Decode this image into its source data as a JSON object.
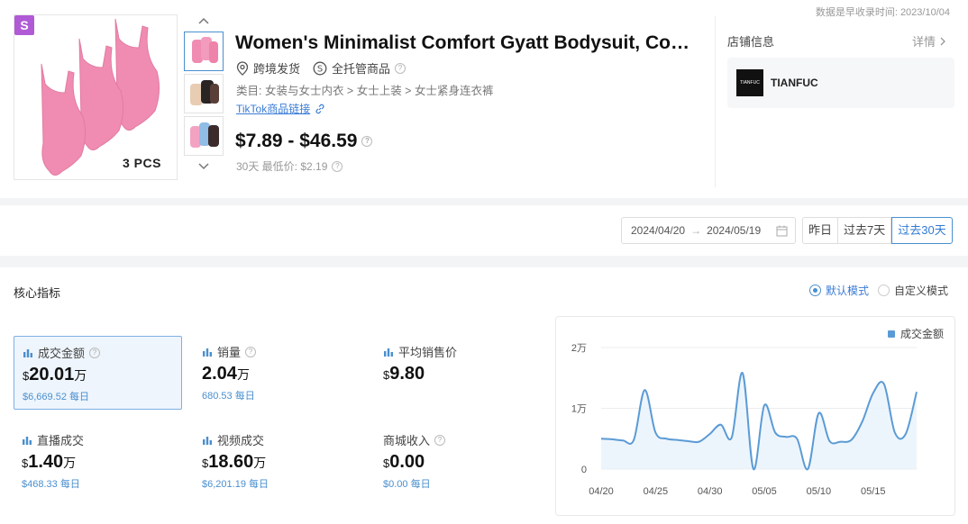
{
  "record_time": "数据是早收录时间: 2023/10/04",
  "product": {
    "badge": "S",
    "pcs_label": "3 PCS",
    "title": "Women's Minimalist Comfort Gyatt Bodysuit, Comf...",
    "shipping": "跨境发货",
    "managed": "全托管商品",
    "category": "类目: 女装与女士内衣 > 女士上装 > 女士紧身连衣裤",
    "tiktok_link": "TikTok商品链接",
    "price": "$7.89 - $46.59",
    "low_price": "30天 最低价: $2.19"
  },
  "shop": {
    "title": "店铺信息",
    "detail": "详情",
    "logo_text": "TIANFUC",
    "name": "TIANFUC"
  },
  "date_filter": {
    "start": "2024/04/20",
    "arrow": "→",
    "end": "2024/05/19",
    "buttons": [
      "昨日",
      "过去7天",
      "过去30天"
    ],
    "active_index": 2
  },
  "metrics": {
    "section_title": "核心指标",
    "modes": [
      "默认模式",
      "自定义模式"
    ],
    "active_mode": 0,
    "cards": [
      {
        "label": "成交金额",
        "currency": "$",
        "value": "20.01",
        "unit": "万",
        "sub": "$6,669.52 每日",
        "help": true,
        "selected": true
      },
      {
        "label": "销量",
        "currency": "",
        "value": "2.04",
        "unit": "万",
        "sub": "680.53 每日",
        "help": true,
        "selected": false
      },
      {
        "label": "平均销售价",
        "currency": "$",
        "value": "9.80",
        "unit": "",
        "sub": "",
        "help": false,
        "selected": false
      },
      {
        "label": "直播成交",
        "currency": "$",
        "value": "1.40",
        "unit": "万",
        "sub": "$468.33 每日",
        "help": false,
        "selected": false
      },
      {
        "label": "视频成交",
        "currency": "$",
        "value": "18.60",
        "unit": "万",
        "sub": "$6,201.19 每日",
        "help": false,
        "selected": false
      },
      {
        "label": "商城收入",
        "currency": "$",
        "value": "0.00",
        "unit": "",
        "sub": "$0.00 每日",
        "help": true,
        "selected": false
      }
    ]
  },
  "colors": {
    "accent": "#4a8fcf",
    "series": "#5b9bd5",
    "area": "#e9f2fb"
  },
  "chart_data": {
    "type": "line",
    "series": [
      {
        "name": "成交金额",
        "values": [
          5000,
          4900,
          4700,
          4800,
          13000,
          6000,
          5000,
          4800,
          4600,
          4500,
          5800,
          7300,
          5200,
          15800,
          0,
          10500,
          6000,
          5300,
          5000,
          0,
          9200,
          4600,
          4500,
          4800,
          7800,
          12500,
          14000,
          6000,
          5800,
          12700
        ]
      }
    ],
    "x": [
      "04/20",
      "04/21",
      "04/22",
      "04/23",
      "04/24",
      "04/25",
      "04/26",
      "04/27",
      "04/28",
      "04/29",
      "04/30",
      "05/01",
      "05/02",
      "05/03",
      "05/04",
      "05/05",
      "05/06",
      "05/07",
      "05/08",
      "05/09",
      "05/10",
      "05/11",
      "05/12",
      "05/13",
      "05/14",
      "05/15",
      "05/16",
      "05/17",
      "05/18",
      "05/19"
    ],
    "x_tick_labels": [
      "04/20",
      "04/25",
      "04/30",
      "05/05",
      "05/10",
      "05/15"
    ],
    "y_tick_labels": [
      "0",
      "1万",
      "2万"
    ],
    "ylim": [
      0,
      20000
    ],
    "grid": true,
    "legend": "top-right"
  }
}
